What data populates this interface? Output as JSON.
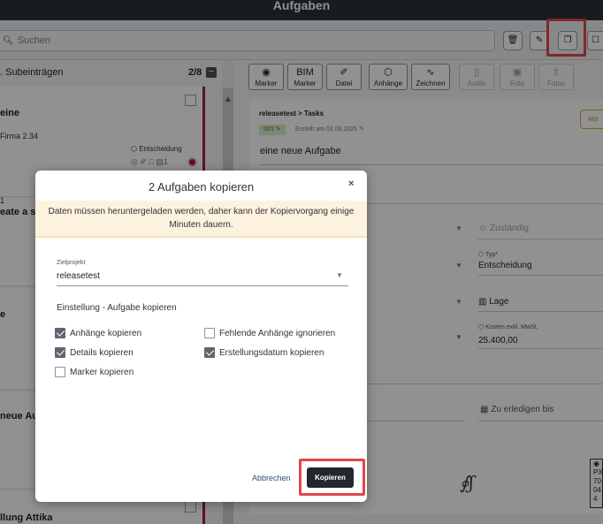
{
  "app": {
    "title": "Aufgaben",
    "search_placeholder": "Suchen"
  },
  "toolbar": {
    "icons": [
      "trash-icon",
      "pen-icon",
      "copy-icon",
      "clipboard-icon"
    ]
  },
  "left_pane": {
    "header": ". Subeinträgen",
    "count": "2/8",
    "collapse": "−",
    "cards": [
      {
        "title": "eine",
        "subtitle": "Firma 2.34",
        "tag": "Entscheidung",
        "icons_count": "1"
      },
      {
        "title": "eate a su",
        "number": "1"
      },
      {
        "title": "e"
      },
      {
        "title": "neue Auf"
      },
      {
        "title": "llung Attika"
      }
    ]
  },
  "attachment_toolbar": [
    {
      "label": "Marker",
      "icon": "pin-icon",
      "disabled": false
    },
    {
      "label": "Marker",
      "icon_text": "BIM",
      "disabled": false
    },
    {
      "label": "Datei",
      "icon": "paperclip-icon",
      "disabled": false
    },
    {
      "label": "Anhänge",
      "icon": "box-icon",
      "disabled": false
    },
    {
      "label": "Zeichnen",
      "icon": "scribble-icon",
      "disabled": false
    },
    {
      "label": "Audio",
      "icon": "mic-icon",
      "disabled": true
    },
    {
      "label": "Foto",
      "icon": "camera-icon",
      "disabled": true
    },
    {
      "label": "Fotos",
      "icon": "upload-icon",
      "disabled": true
    }
  ],
  "detail": {
    "breadcrumb": "releasetest > Tasks",
    "id_badge": "001",
    "created": "Erstellt am 02.06.2025",
    "priority_badge": "Mitt",
    "title": "eine neue Aufgabe",
    "assignee_placeholder": "Zuständig",
    "type_label": "Typ",
    "type_required": "*",
    "type_value": "Entscheidung",
    "location_placeholder": "Lage",
    "cost_label": "Kosten exkl. MwSt.",
    "cost_value": "25.400,00",
    "due_placeholder": "Zu erledigen bis",
    "px_text": [
      "PX",
      "70",
      "04",
      "4"
    ]
  },
  "dialog": {
    "title": "2 Aufgaben kopieren",
    "close": "×",
    "warning": "Daten müssen heruntergeladen werden, daher kann der Kopiervorgang einige Minuten dauern.",
    "target_label": "Zielprojekt",
    "target_value": "releasetest",
    "section_title": "Einstellung - Aufgabe kopieren",
    "options": [
      {
        "label": "Anhänge kopieren",
        "checked": true
      },
      {
        "label": "Fehlende Anhänge ignorieren",
        "checked": false
      },
      {
        "label": "Details kopieren",
        "checked": true
      },
      {
        "label": "Erstellungsdatum kopieren",
        "checked": true
      },
      {
        "label": "Marker kopieren",
        "checked": false
      }
    ],
    "cancel_label": "Abbrechen",
    "confirm_label": "Kopieren"
  }
}
